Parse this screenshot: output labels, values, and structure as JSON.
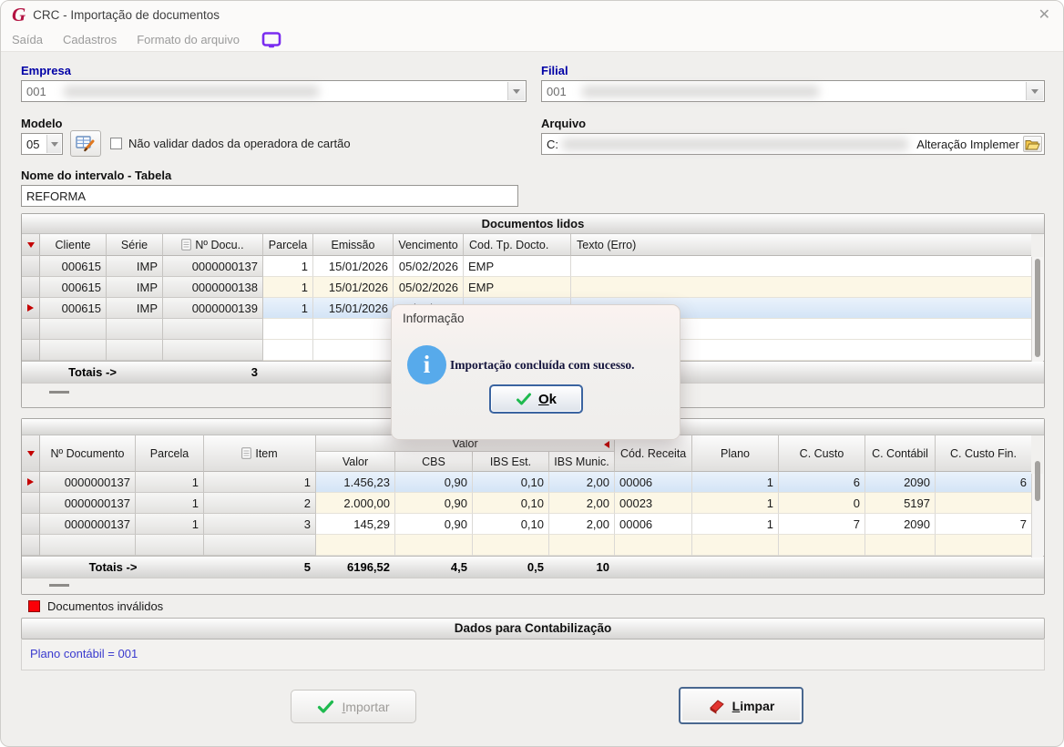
{
  "window": {
    "title": "CRC - Importação de documentos",
    "close_symbol": "✕"
  },
  "menu": {
    "items": [
      "Saída",
      "Cadastros",
      "Formato do arquivo"
    ]
  },
  "form": {
    "empresa": {
      "label": "Empresa",
      "value": "001"
    },
    "filial": {
      "label": "Filial",
      "value": "001"
    },
    "modelo": {
      "label": "Modelo",
      "value": "05"
    },
    "validar_checkbox": {
      "label": "Não validar dados da operadora de cartão",
      "checked": false
    },
    "arquivo": {
      "label": "Arquivo",
      "value_prefix": "C:",
      "value_suffix": "Alteração Implemer"
    },
    "intervalo": {
      "label": "Nome do intervalo - Tabela",
      "value": "REFORMA"
    }
  },
  "docs_table": {
    "title": "Documentos lidos",
    "headers": {
      "cliente": "Cliente",
      "serie": "Série",
      "num_doc": "Nº Docu..",
      "parcela": "Parcela",
      "emissao": "Emissão",
      "vencimento": "Vencimento",
      "cod_tp": "Cod. Tp. Docto.",
      "texto": "Texto (Erro)"
    },
    "rows": [
      {
        "cliente": "000615",
        "serie": "IMP",
        "num_doc": "0000000137",
        "parcela": "1",
        "emissao": "15/01/2026",
        "vencimento": "05/02/2026",
        "cod_tp": "EMP",
        "texto": ""
      },
      {
        "cliente": "000615",
        "serie": "IMP",
        "num_doc": "0000000138",
        "parcela": "1",
        "emissao": "15/01/2026",
        "vencimento": "05/02/2026",
        "cod_tp": "EMP",
        "texto": ""
      },
      {
        "cliente": "000615",
        "serie": "IMP",
        "num_doc": "0000000139",
        "parcela": "1",
        "emissao": "15/01/2026",
        "vencimento": "05/02/2026",
        "cod_tp": "EMP",
        "texto": ""
      }
    ],
    "totals": {
      "label": "Totais ->",
      "count": "3"
    }
  },
  "items_table": {
    "title": "",
    "headers": {
      "num_doc": "Nº Documento",
      "parcela": "Parcela",
      "item": "Item",
      "valor_group": "Valor",
      "valor": "Valor",
      "cbs": "CBS",
      "ibs_est": "IBS Est.",
      "ibs_mun": "IBS Munic.",
      "cod_receita": "Cód. Receita",
      "plano": "Plano",
      "c_custo": "C. Custo",
      "c_contabil": "C. Contábil",
      "c_custo_fin": "C. Custo Fin."
    },
    "rows": [
      {
        "num_doc": "0000000137",
        "parcela": "1",
        "item": "1",
        "valor": "1.456,23",
        "cbs": "0,90",
        "ibs_est": "0,10",
        "ibs_mun": "2,00",
        "cod_receita": "00006",
        "plano": "1",
        "c_custo": "6",
        "c_contabil": "2090",
        "c_custo_fin": "6"
      },
      {
        "num_doc": "0000000137",
        "parcela": "1",
        "item": "2",
        "valor": "2.000,00",
        "cbs": "0,90",
        "ibs_est": "0,10",
        "ibs_mun": "2,00",
        "cod_receita": "00023",
        "plano": "1",
        "c_custo": "0",
        "c_contabil": "5197",
        "c_custo_fin": ""
      },
      {
        "num_doc": "0000000137",
        "parcela": "1",
        "item": "3",
        "valor": "145,29",
        "cbs": "0,90",
        "ibs_est": "0,10",
        "ibs_mun": "2,00",
        "cod_receita": "00006",
        "plano": "1",
        "c_custo": "7",
        "c_contabil": "2090",
        "c_custo_fin": "7"
      }
    ],
    "totals": {
      "label": "Totais ->",
      "count": "5",
      "valor": "6196,52",
      "cbs": "4,5",
      "ibs_est": "0,5",
      "ibs_mun": "10"
    }
  },
  "legend": {
    "invalid_docs": "Documentos inválidos"
  },
  "contabilizacao": {
    "title": "Dados para Contabilização",
    "info": "Plano contábil = 001"
  },
  "actions": {
    "importar": "Importar",
    "limpar": "Limpar"
  },
  "dialog": {
    "title": "Informação",
    "message": "Importação concluída com sucesso.",
    "ok": "Ok"
  },
  "colors": {
    "label_blue": "#0000A6",
    "info_blue": "#57AAEB",
    "selected_row": "#D9E7F7",
    "stripe_cream": "#FCF7E6",
    "marker_red": "#C40000",
    "legend_red": "#FB0007",
    "logo_crimson": "#B31342",
    "menu_icon_purple": "#7A2CF0",
    "link_blue": "#3A3ACE"
  }
}
